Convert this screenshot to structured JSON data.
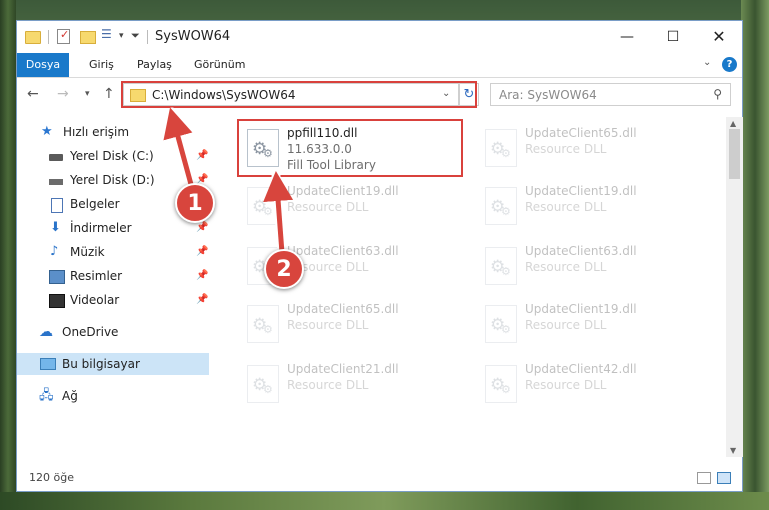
{
  "window": {
    "title": "SysWOW64",
    "controls": {
      "minimize": "—",
      "maximize": "☐",
      "close": "✕"
    }
  },
  "ribbon": {
    "tabs": [
      "Dosya",
      "Giriş",
      "Paylaş",
      "Görünüm"
    ],
    "help": "?"
  },
  "address": {
    "path": "C:\\Windows\\SysWOW64",
    "search_placeholder": "Ara: SysWOW64"
  },
  "sidebar": {
    "items": [
      {
        "label": "Hızlı erişim",
        "icon": "star-icon",
        "pinned": false
      },
      {
        "label": "Yerel Disk (C:)",
        "icon": "drive-icon",
        "pinned": true
      },
      {
        "label": "Yerel Disk (D:)",
        "icon": "drive-icon",
        "pinned": true
      },
      {
        "label": "Belgeler",
        "icon": "documents-icon",
        "pinned": true
      },
      {
        "label": "İndirmeler",
        "icon": "download-icon",
        "pinned": true
      },
      {
        "label": "Müzik",
        "icon": "music-icon",
        "pinned": true
      },
      {
        "label": "Resimler",
        "icon": "pictures-icon",
        "pinned": true
      },
      {
        "label": "Videolar",
        "icon": "videos-icon",
        "pinned": true
      },
      {
        "label": "OneDrive",
        "icon": "cloud-icon",
        "pinned": false
      },
      {
        "label": "Bu bilgisayar",
        "icon": "computer-icon",
        "pinned": false,
        "selected": true
      },
      {
        "label": "Ağ",
        "icon": "network-icon",
        "pinned": false
      }
    ]
  },
  "files": [
    {
      "name": "ppfill110.dll",
      "line2": "11.633.0.0",
      "line3": "Fill Tool Library",
      "highlighted": true
    },
    {
      "name": "UpdateClient65.dll",
      "line2": "Resource DLL"
    },
    {
      "name": "UpdateClient19.dll",
      "line2": "Resource DLL"
    },
    {
      "name": "UpdateClient19.dll",
      "line2": "Resource DLL"
    },
    {
      "name": "UpdateClient63.dll",
      "line2": "Resource DLL"
    },
    {
      "name": "UpdateClient63.dll",
      "line2": "Resource DLL"
    },
    {
      "name": "UpdateClient65.dll",
      "line2": "Resource DLL"
    },
    {
      "name": "UpdateClient19.dll",
      "line2": "Resource DLL"
    },
    {
      "name": "UpdateClient21.dll",
      "line2": "Resource DLL"
    },
    {
      "name": "UpdateClient42.dll",
      "line2": "Resource DLL"
    }
  ],
  "status": {
    "item_count": "120 öğe"
  },
  "annotations": {
    "step1": "1",
    "step2": "2"
  },
  "colors": {
    "accent": "#1979ca",
    "highlight": "#d9413c",
    "selection": "#cce4f7"
  }
}
